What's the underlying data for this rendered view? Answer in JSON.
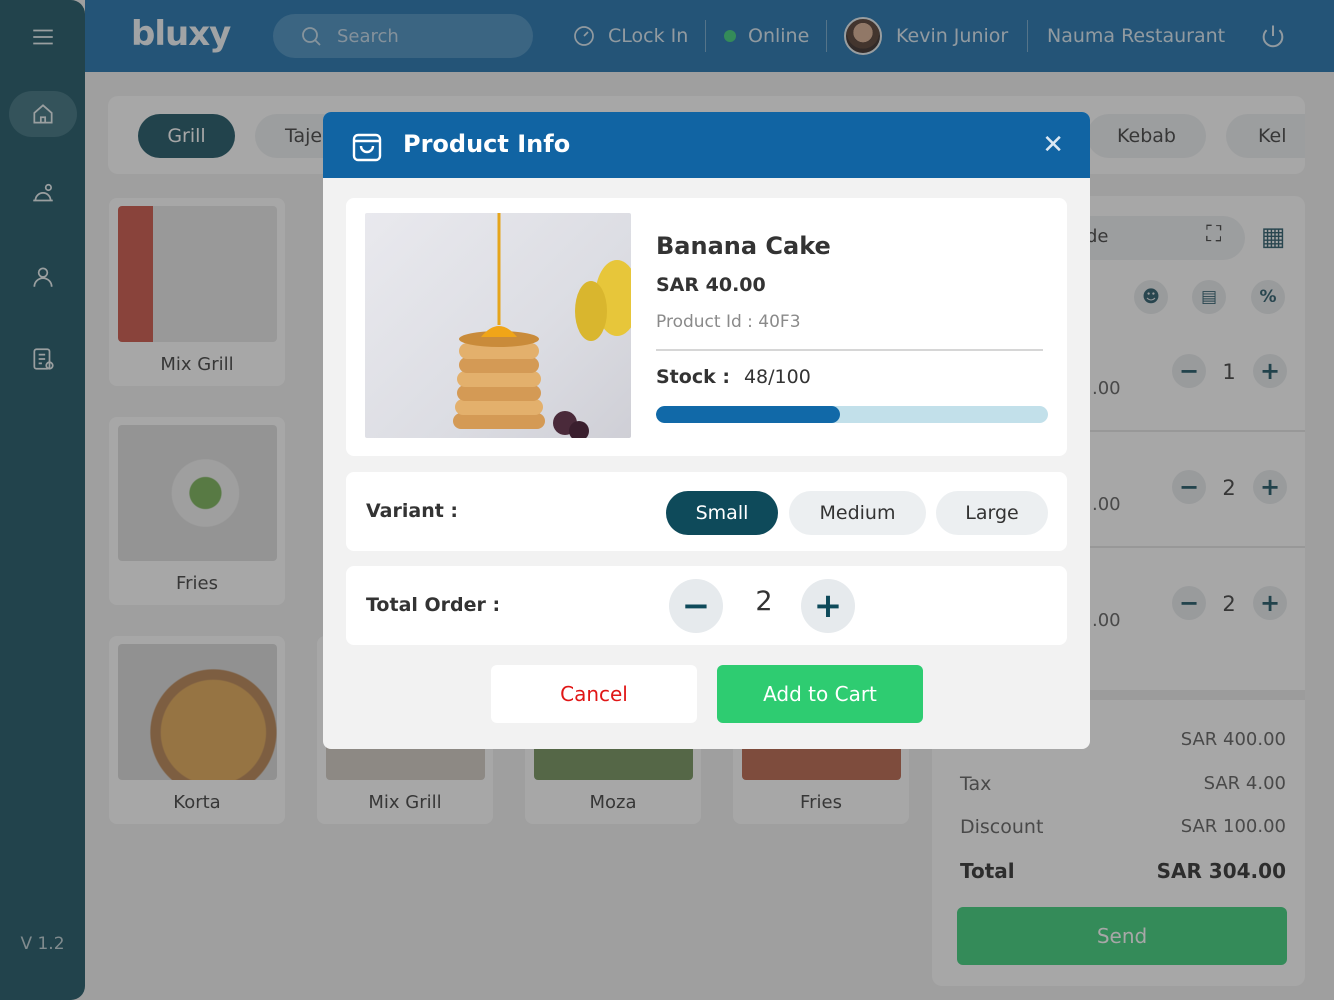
{
  "app": {
    "logo": "bluxy",
    "version": "V 1.2"
  },
  "topbar": {
    "search_placeholder": "Search",
    "clock_in_label": "CLock In",
    "status_label": "Online",
    "user_name": "Kevin Junior",
    "restaurant_name": "Nauma Restaurant"
  },
  "categories": [
    "Grill",
    "Taje",
    "Kebab",
    "Kel"
  ],
  "products": [
    {
      "name": "Mix Grill"
    },
    {
      "name": "Fries"
    },
    {
      "name": "Korta"
    },
    {
      "name": "Mix Grill"
    },
    {
      "name": "Moza"
    },
    {
      "name": "Fries"
    }
  ],
  "cart": {
    "search_fragment": "de",
    "items": [
      {
        "price_fragment": ".00",
        "qty": "1"
      },
      {
        "price_fragment": ".00",
        "qty": "2"
      },
      {
        "price_fragment": ".00",
        "qty": "2"
      }
    ],
    "subtotal_value": "SAR 400.00",
    "tax_label": "Tax",
    "tax_value": "SAR 4.00",
    "discount_label": "Discount",
    "discount_value": "SAR 100.00",
    "total_label": "Total",
    "total_value": "SAR 304.00",
    "send_label": "Send"
  },
  "modal": {
    "title": "Product Info",
    "close_icon": "close-icon",
    "product_name": "Banana Cake",
    "product_price": "SAR 40.00",
    "product_id": "Product Id : 40F3",
    "stock_label": "Stock :",
    "stock_value": "48/100",
    "stock_fraction": 0.47,
    "variant_label": "Variant :",
    "variants": [
      "Small",
      "Medium",
      "Large"
    ],
    "selected_variant": "Small",
    "total_order_label": "Total Order :",
    "total_order_value": "2",
    "cancel_label": "Cancel",
    "add_to_cart_label": "Add to Cart"
  },
  "colors": {
    "sidebar": "#0e4a5a",
    "topbar": "#1169a8",
    "modal_header": "#1164a3",
    "accent_green": "#2ecc71",
    "cancel_red": "#e01616"
  }
}
